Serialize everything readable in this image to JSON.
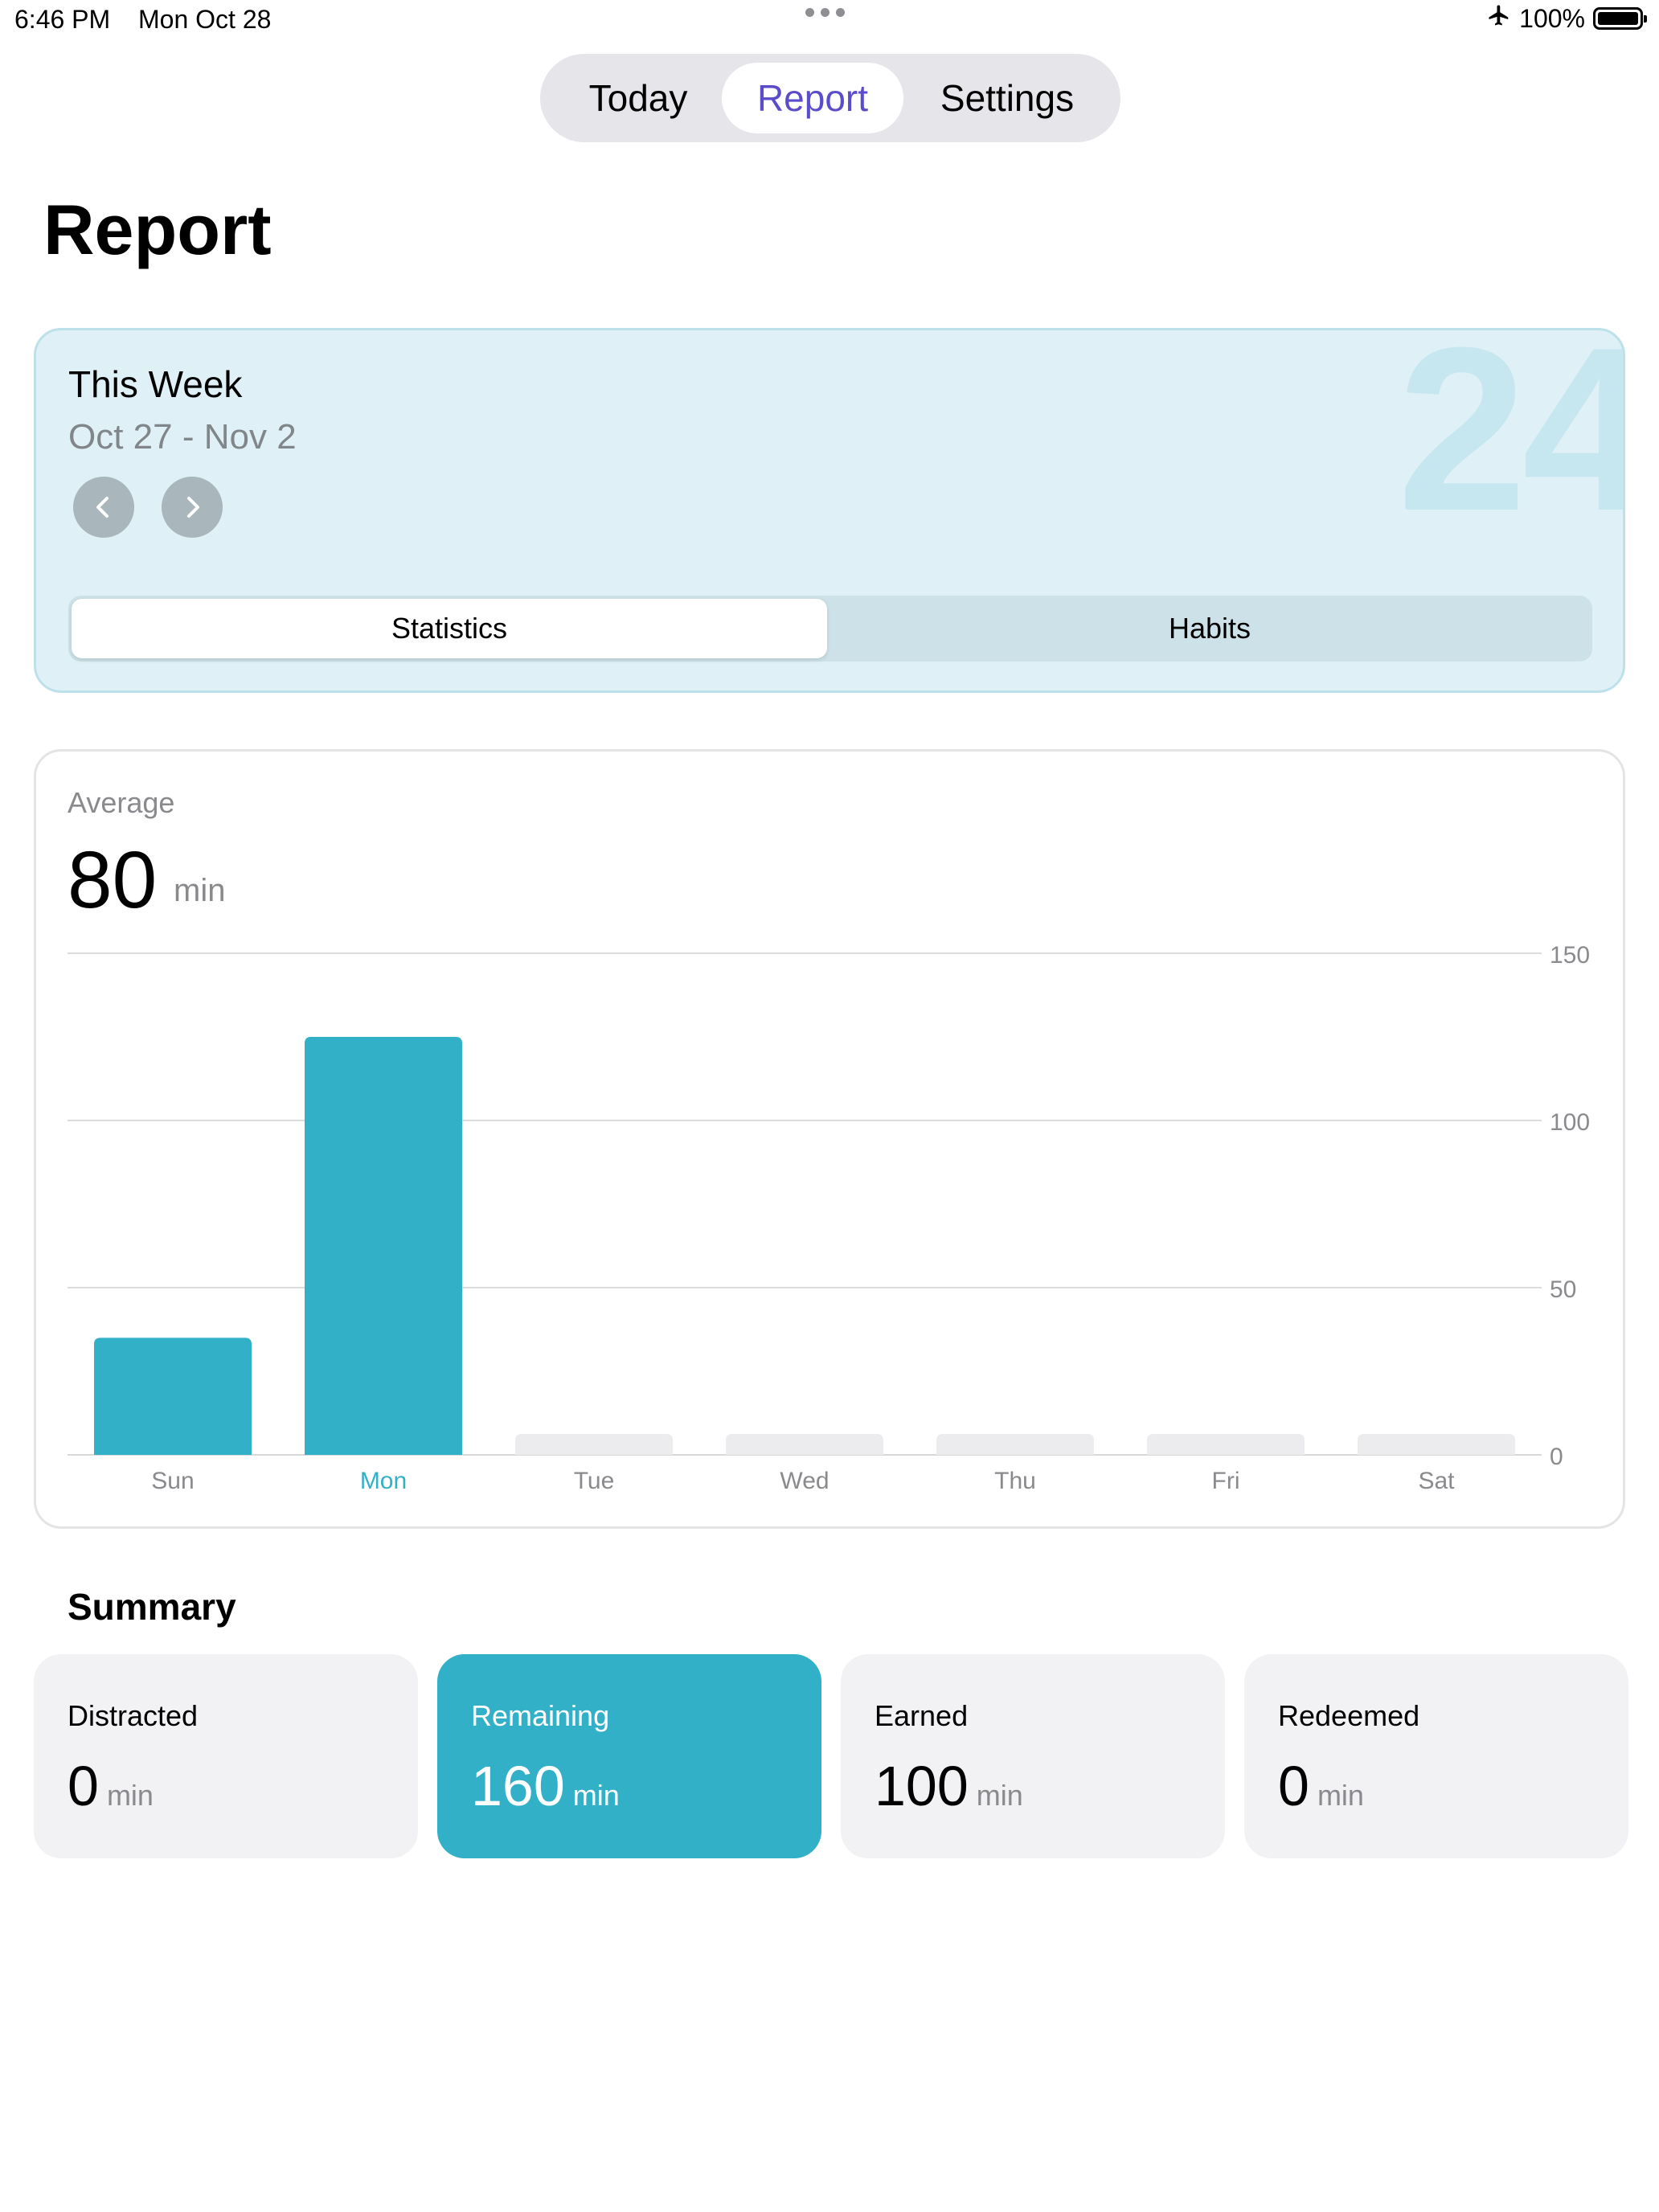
{
  "status_bar": {
    "time": "6:46 PM",
    "date": "Mon Oct 28",
    "battery": "100%",
    "icons": [
      "airplane-icon",
      "battery-icon"
    ]
  },
  "nav": {
    "tabs": [
      "Today",
      "Report",
      "Settings"
    ],
    "active": "Report",
    "active_color": "#5b4ccc"
  },
  "page": {
    "title": "Report"
  },
  "week": {
    "title": "This Week",
    "range": "Oct 27 - Nov 2",
    "big_number": "24",
    "segments": [
      "Statistics",
      "Habits"
    ],
    "active_segment": "Statistics",
    "icons": [
      "chevron-left-icon",
      "chevron-right-icon"
    ]
  },
  "stats": {
    "average_label": "Average",
    "average_value": "80",
    "unit": "min"
  },
  "chart_data": {
    "type": "bar",
    "categories": [
      "Sun",
      "Mon",
      "Tue",
      "Wed",
      "Thu",
      "Fri",
      "Sat"
    ],
    "values": [
      35,
      125,
      0,
      0,
      0,
      0,
      0
    ],
    "highlight": "Mon",
    "ylim": [
      0,
      150
    ],
    "yticks": [
      0,
      50,
      100,
      150
    ],
    "y_axis_position": "right",
    "grid": true,
    "bar_color": "#31b0c8",
    "empty_bar_color": "#ececef"
  },
  "summary": {
    "title": "Summary",
    "tiles": [
      {
        "label": "Distracted",
        "value": "0",
        "unit": "min"
      },
      {
        "label": "Remaining",
        "value": "160",
        "unit": "min",
        "active": true
      },
      {
        "label": "Earned",
        "value": "100",
        "unit": "min"
      },
      {
        "label": "Redeemed",
        "value": "0",
        "unit": "min"
      }
    ],
    "accent_color": "#31b0c8"
  }
}
